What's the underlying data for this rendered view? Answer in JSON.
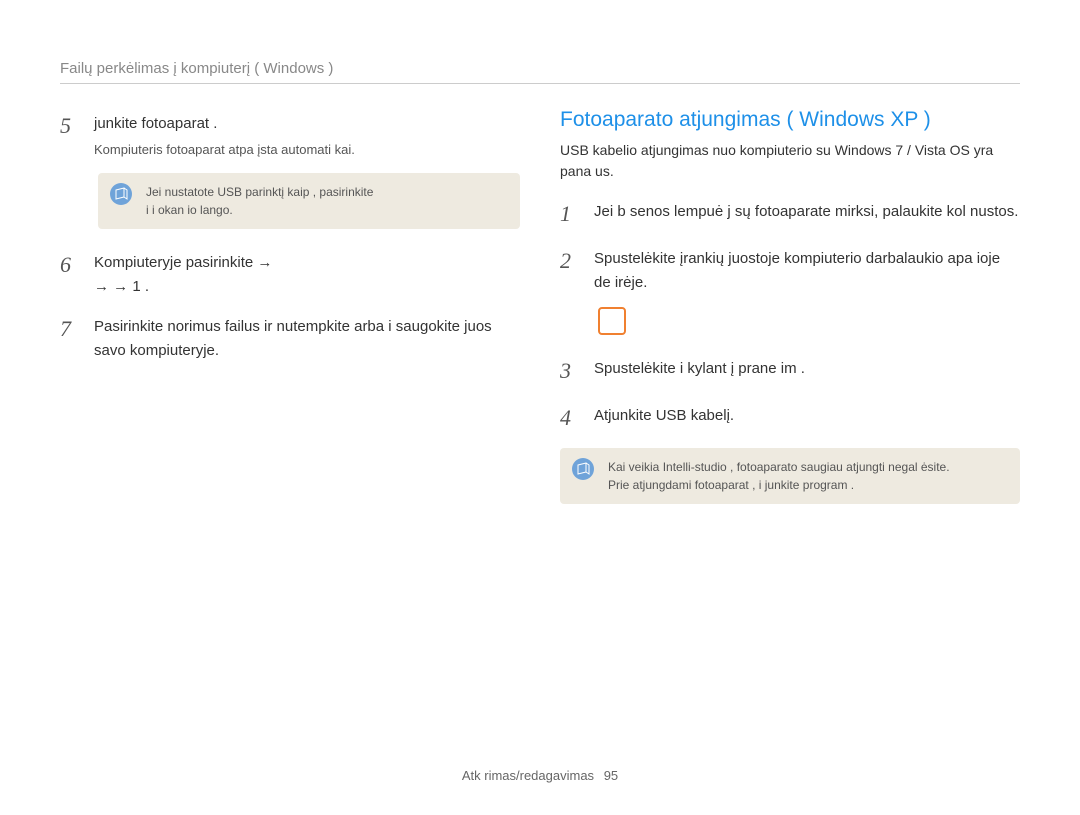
{
  "breadcrumb": "Failų perkėlimas į kompiuterį ( Windows )",
  "left": {
    "step5": {
      "num": "5",
      "title": "junkite fotoaparat .",
      "sub": "Kompiuteris fotoaparat    atpa įsta automati kai."
    },
    "note1": "Jei nustatote USB parinktį kaip  , pasirinkite\n  i  i  okan   io lango.",
    "step6": {
      "num": "6",
      "body": "Kompiuteryje pasirinkite   →\n         → → 1                    ."
    },
    "step7": {
      "num": "7",
      "body": "Pasirinkite norimus failus ir nutempkite arba i saugokite juos savo kompiuteryje."
    }
  },
  "right": {
    "title": "Fotoaparato atjungimas ( Windows XP )",
    "sub": "USB kabelio atjungimas nuo kompiuterio su  Windows 7  / Vista OS yra pana us.",
    "step1": {
      "num": "1",
      "body": "Jei b   senos lempuė  j   sų fotoaparate mirksi, palaukite kol nustos."
    },
    "step2": {
      "num": "2",
      "body": "Spustelėkite       įrankių juostoje kompiuterio darbalaukio apa   ioje de irėje."
    },
    "step3": {
      "num": "3",
      "body": "Spustelėkite i kylant į prane im    ."
    },
    "step4": {
      "num": "4",
      "body": "Atjunkite USB kabelį."
    },
    "note2": "Kai veikia  Intelli-studio , fotoaparato saugiau atjungti negal ėsite.\nPrie  atjungdami fotoaparat   , i junkite program   ."
  },
  "footer": {
    "label": "Atk  rimas/redagavimas",
    "page": "95"
  }
}
